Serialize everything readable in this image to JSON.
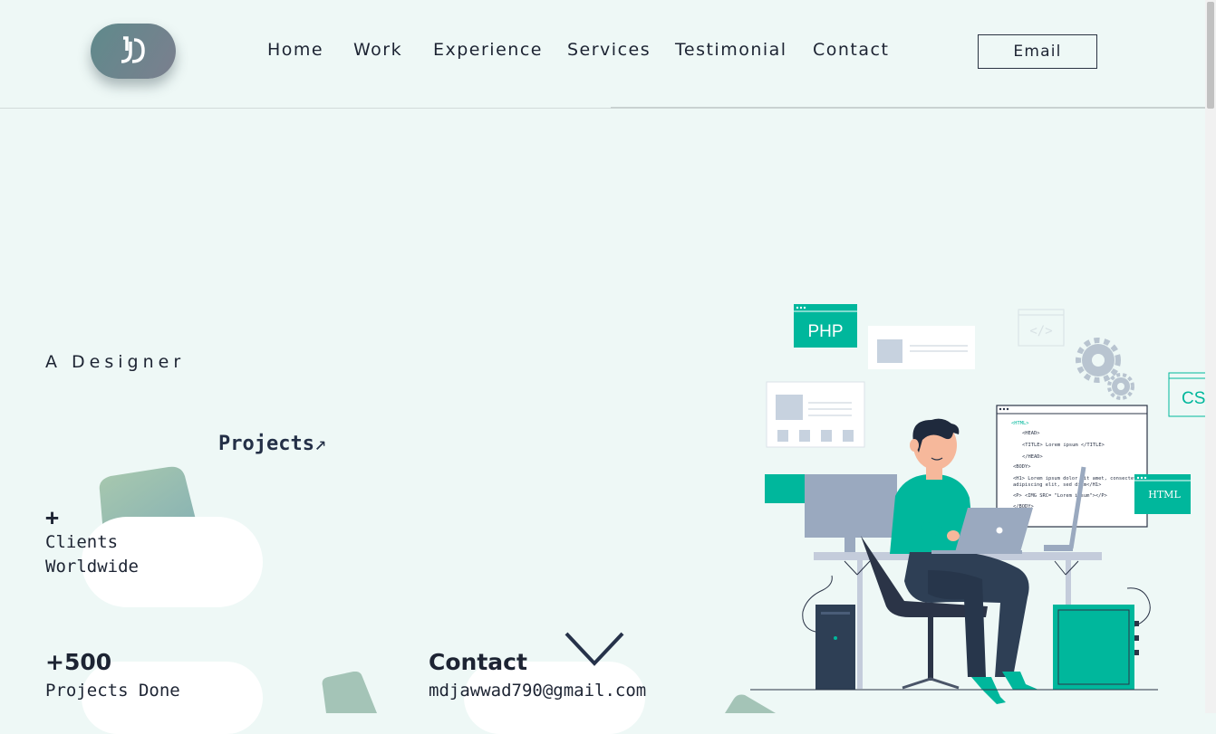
{
  "nav": {
    "items": [
      "Home",
      "Work",
      "Experience",
      "Services",
      "Testimonial",
      "Contact"
    ],
    "email_button": "Email"
  },
  "hero": {
    "role": "A Designer",
    "projects_link": "Projects",
    "projects_arrow": "↗"
  },
  "stats": {
    "clients": {
      "value": "+",
      "label_line1": "Clients",
      "label_line2": "Worldwide"
    },
    "projects": {
      "value": "+500",
      "label": "Projects Done"
    },
    "contact": {
      "title": "Contact",
      "email": "mdjawwad790@gmail.com"
    }
  },
  "illustration": {
    "php_label": "PHP",
    "html_label": "HTML",
    "css_label": "CS",
    "code_tag": "</>",
    "code_lines": [
      "<HTML>",
      "<HEAD>",
      "<TITLE> Lorem ipsum </TITLE>",
      "</HEAD>",
      "<BODY>",
      "<H1> Lorem ipsum dolor sit amet, consectetuer",
      "adipiscing elit, sed diam</H1>",
      "<P> <IMG SRC= \"Lorem ipsum\"></P>",
      "</BODY>"
    ]
  },
  "colors": {
    "accent": "#00b79c",
    "text": "#1d2433",
    "background": "#eef8f6"
  }
}
